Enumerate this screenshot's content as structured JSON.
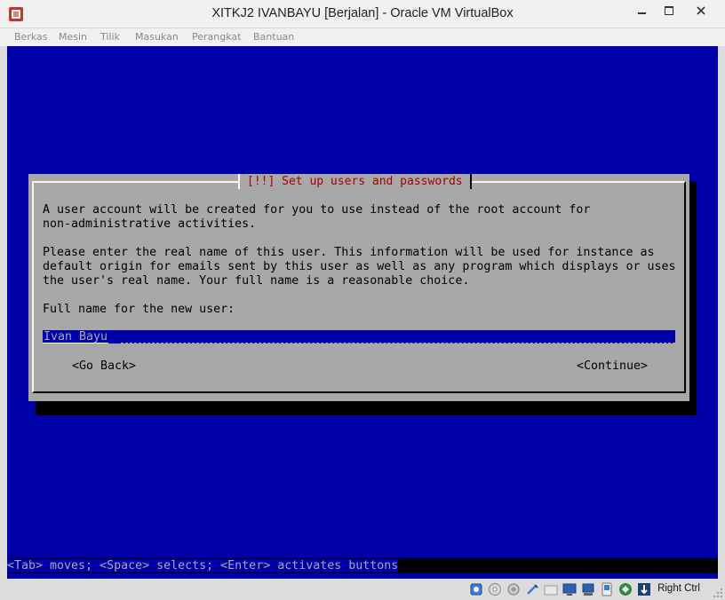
{
  "window": {
    "title": "XITKJ2 IVANBAYU [Berjalan] - Oracle VM VirtualBox",
    "app_icon": "virtualbox-icon"
  },
  "menubar": {
    "items": [
      {
        "label": "Berkas"
      },
      {
        "label": "Mesin"
      },
      {
        "label": "Tilik"
      },
      {
        "label": "Masukan"
      },
      {
        "label": "Perangkat"
      },
      {
        "label": "Bantuan"
      }
    ]
  },
  "installer": {
    "dialog_title": "[!!] Set up users and passwords",
    "paragraph1_line1": "A user account will be created for you to use instead of the root account for",
    "paragraph1_line2": "non-administrative activities.",
    "paragraph2_line1": "Please enter the real name of this user. This information will be used for instance as",
    "paragraph2_line2": "default origin for emails sent by this user as well as any program which displays or uses",
    "paragraph2_line3": "the user's real name. Your full name is a reasonable choice.",
    "prompt": "Full name for the new user:",
    "full_name_value": "Ivan Bayu",
    "go_back_label": "<Go Back>",
    "continue_label": "<Continue>",
    "hint": "<Tab> moves; <Space> selects; <Enter> activates buttons"
  },
  "statusbar": {
    "icons": [
      "hard-disk-icon",
      "optical-disk-icon",
      "audio-icon",
      "usb-icon",
      "shared-folder-icon",
      "display-icon",
      "network-icon",
      "video-capture-icon",
      "cpu-icon",
      "mouse-integration-icon"
    ],
    "host_key": "Right Ctrl"
  },
  "colors": {
    "console_blue": "#0000a8",
    "dialog_gray": "#a8a8a8",
    "title_red": "#a80000"
  }
}
